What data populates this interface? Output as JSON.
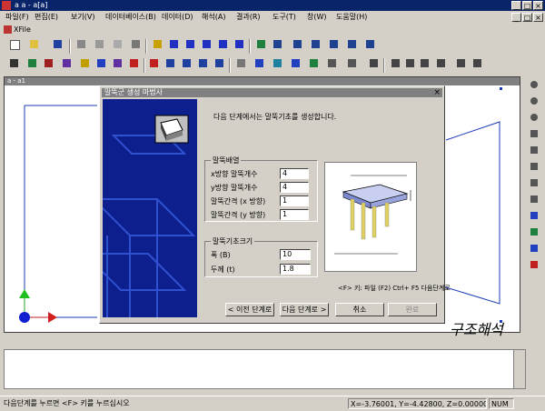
{
  "app": {
    "title": "a a - a[a]",
    "doc_tab": "XFile",
    "canvas_title": "a - a1"
  },
  "menu": [
    "파일(F)",
    "편집(E)",
    "보기(V)",
    "데이터베이스(B)",
    "데이터(D)",
    "해석(A)",
    "결과(R)",
    "도구(T)",
    "창(W)",
    "도움말(H)"
  ],
  "toolbar": {
    "row1_icons": [
      "new-icon",
      "open-icon",
      "save-icon",
      "cut-icon",
      "copy-icon",
      "paste-icon",
      "print-icon",
      "node-icon",
      "element-icon",
      "grid-icon",
      "mesh-icon",
      "section-icon",
      "table-icon",
      "view1-icon",
      "view2-icon",
      "view3-icon",
      "view4-icon",
      "view5-icon",
      "view6-icon"
    ],
    "row2_icons": [
      "select-icon",
      "zoom-icon",
      "pan-icon",
      "rotate-icon",
      "measure-icon",
      "move-icon",
      "support-icon",
      "load-icon",
      "spring-icon",
      "link-icon",
      "fix-icon",
      "wire-icon",
      "solid-icon",
      "shade-icon",
      "render-icon",
      "print2-icon",
      "edit-icon",
      "cursor-icon",
      "align-v-icon",
      "align-h-icon",
      "align-l-icon",
      "frame-icon",
      "tree-icon",
      "graph-icon"
    ]
  },
  "right_tools": [
    "zoom-in-icon",
    "zoom-out-icon",
    "zoom-window-icon",
    "zoom-fit-icon",
    "refresh-icon",
    "rotate-view-icon",
    "pan-view-icon",
    "redraw-icon",
    "hidden-icon",
    "axis-icon",
    "dim-icon",
    "label-icon"
  ],
  "dialog": {
    "title": "말뚝군 생성 마법사",
    "close": "×",
    "instruction": "다음 단계에서는 말뚝기초를 생성합니다.",
    "group_layout": {
      "title": "말뚝배열",
      "fields": [
        {
          "label": "x방향 말뚝개수",
          "value": "4"
        },
        {
          "label": "y방향 말뚝개수",
          "value": "4"
        },
        {
          "label": "말뚝간격 (x 방향)",
          "value": "1"
        },
        {
          "label": "말뚝간격 (y 방향)",
          "value": "1"
        }
      ]
    },
    "group_footing": {
      "title": "말뚝기초크기",
      "fields": [
        {
          "label": "폭 (B)",
          "value": "10"
        },
        {
          "label": "두께 (t)",
          "value": "1.8"
        }
      ]
    },
    "hint": "<F> 키: 파일 (F2) Ctrl+ F5 다음단계로",
    "buttons": {
      "back": "< 이전 단계로",
      "next": "다음 단계로 >",
      "cancel": "취소",
      "finish": "완료"
    }
  },
  "watermark": "구조해석",
  "status": {
    "message": "다음단계를 누르면 <F> 키를 누르십시오",
    "coords": "X=-3.76001, Y=-4.42800, Z=0.00000",
    "mode": "NUM"
  }
}
